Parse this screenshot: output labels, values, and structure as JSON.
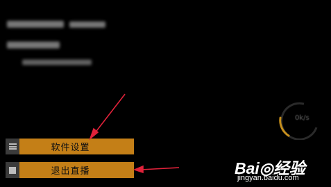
{
  "menu": {
    "settings_label": "软件设置",
    "exit_label": "退出直播"
  },
  "gauge": {
    "speed_text": "0k/s"
  },
  "watermark": {
    "main": "Bai◎经验",
    "sub": "jingyan.baidu.com"
  },
  "colors": {
    "button": "#c47f17",
    "arrow": "#e0223a",
    "gauge_arc": "#e3a21c"
  }
}
